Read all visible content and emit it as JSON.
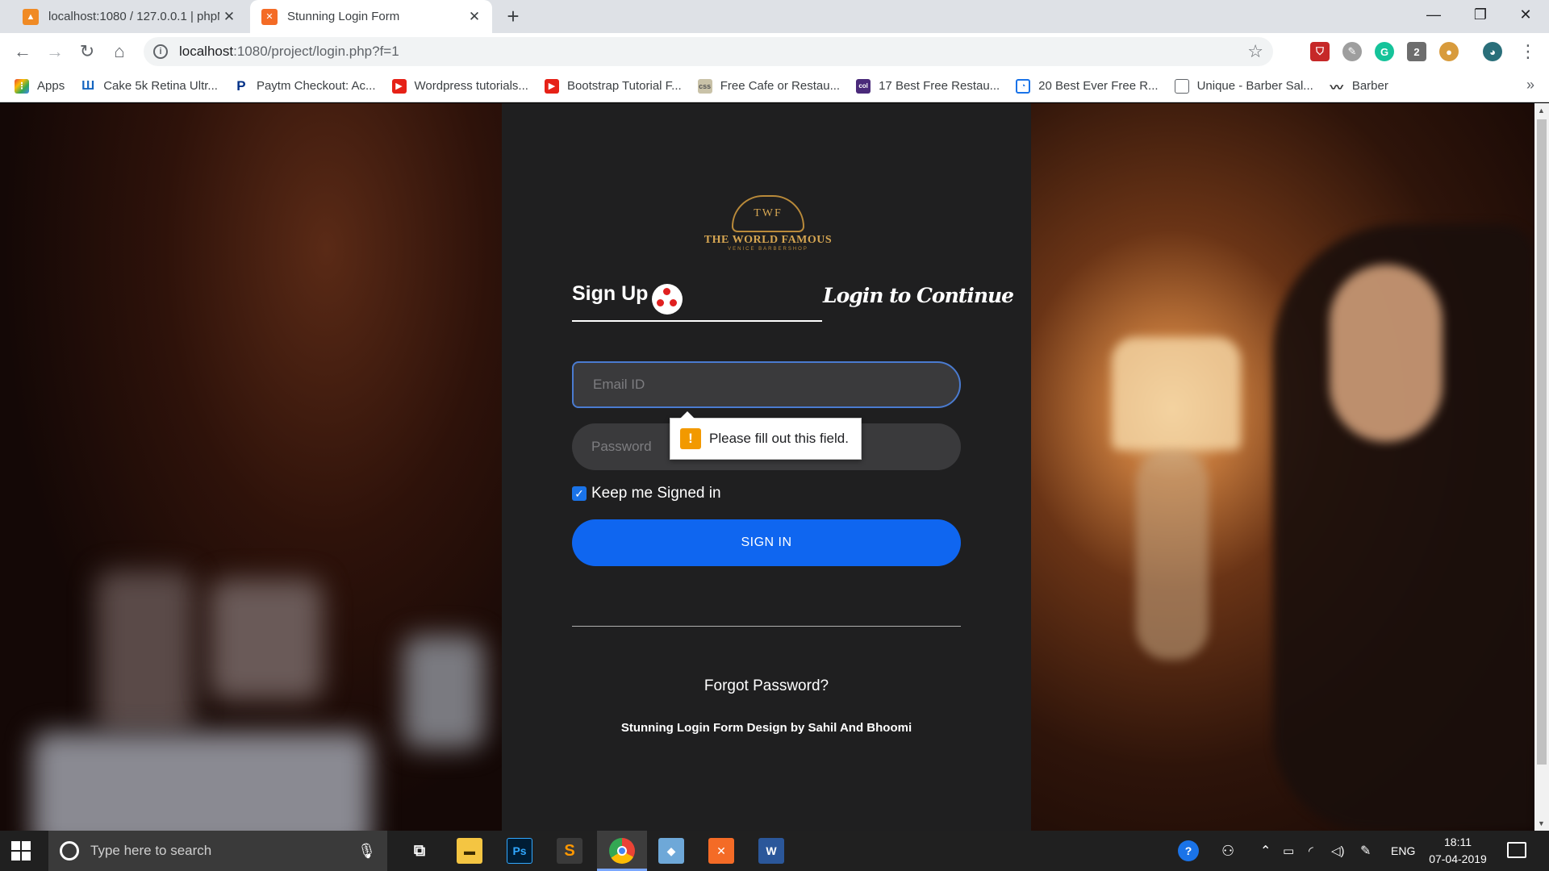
{
  "browser": {
    "tabs": [
      {
        "title": "localhost:1080 / 127.0.0.1 | phpM",
        "favicon": "phpmyadmin-icon",
        "active": false
      },
      {
        "title": "Stunning Login Form",
        "favicon": "xampp-icon",
        "active": true
      }
    ],
    "url_host": "localhost",
    "url_path": ":1080/project/login.php?f=1",
    "extension_badge": "2",
    "bookmarks": [
      {
        "label": "Apps",
        "icon": "apps-grid-icon"
      },
      {
        "label": "Cake 5k Retina Ultr...",
        "icon": "cake-icon"
      },
      {
        "label": "Paytm Checkout: Ac...",
        "icon": "paypal-icon"
      },
      {
        "label": "Wordpress tutorials...",
        "icon": "youtube-icon"
      },
      {
        "label": "Bootstrap Tutorial F...",
        "icon": "youtube-icon"
      },
      {
        "label": "Free Cafe or Restau...",
        "icon": "css-icon"
      },
      {
        "label": "17 Best Free Restau...",
        "icon": "colorlib-icon"
      },
      {
        "label": "20 Best Ever Free R...",
        "icon": "bookmark-page-icon"
      },
      {
        "label": "Unique - Barber Sal...",
        "icon": "document-icon"
      },
      {
        "label": "Barber",
        "icon": "mustache-icon"
      }
    ],
    "bookmarks_more": "»"
  },
  "page": {
    "logo": {
      "crest_text": "TWF",
      "brand": "THE WORLD FAMOUS",
      "subtitle": "VENICE BARBERSHOP"
    },
    "signup_label": "Sign Up",
    "login_label": "Login to Continue",
    "email_placeholder": "Email ID",
    "password_placeholder": "Password",
    "validation_message": "Please fill out this field.",
    "validation_icon": "!",
    "keep_signed_in_label": "Keep me Signed in",
    "keep_signed_in_checked": true,
    "signin_button": "SIGN IN",
    "forgot_password": "Forgot Password?",
    "credit": "Stunning Login Form Design by Sahil And Bhoomi",
    "accent_color": "#0f66f0",
    "card_color": "#1f1f20"
  },
  "taskbar": {
    "search_placeholder": "Type here to search",
    "apps": [
      "file-explorer-icon",
      "photoshop-icon",
      "sublime-text-icon",
      "chrome-icon",
      "virtualbox-icon",
      "xampp-icon",
      "word-icon"
    ],
    "photoshop_label": "Ps",
    "word_label": "W",
    "language": "ENG",
    "time": "18:11",
    "date": "07-04-2019"
  }
}
